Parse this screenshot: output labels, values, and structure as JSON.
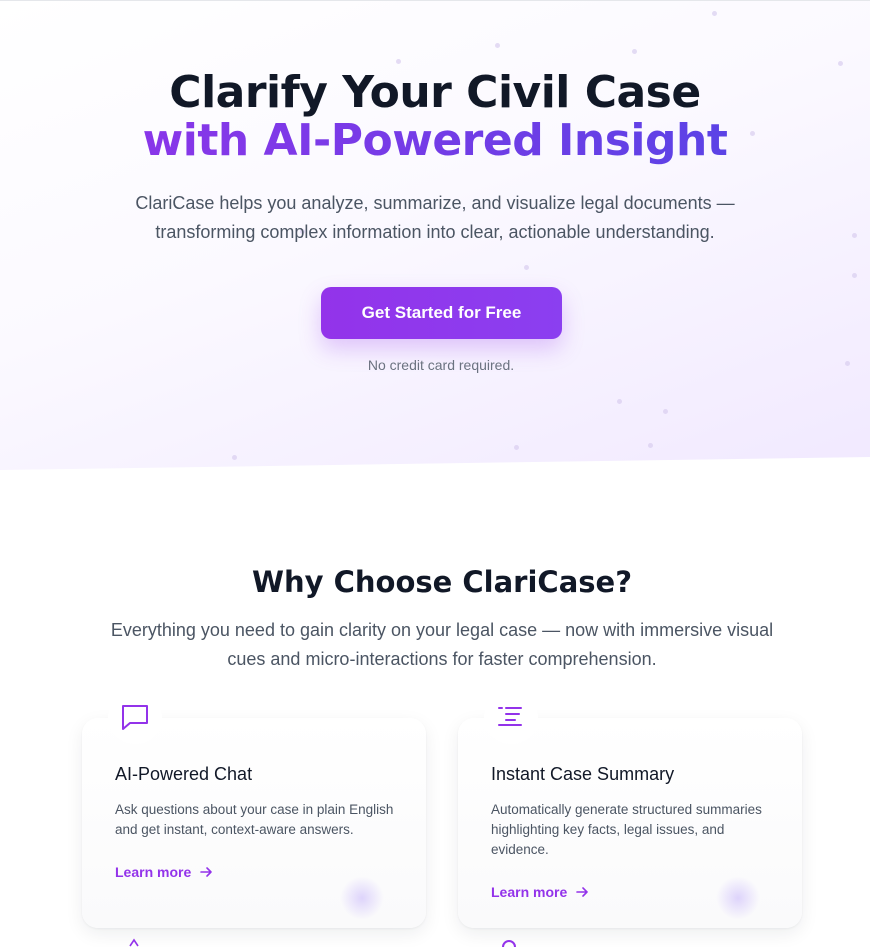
{
  "hero": {
    "title_line1": "Clarify Your Civil Case",
    "title_line2": "with AI-Powered Insight",
    "subtitle": "ClariCase helps you analyze, summarize, and visualize legal documents — transforming complex information into clear, actionable understanding.",
    "cta_label": "Get Started for Free",
    "cta_note": "No credit card required."
  },
  "why": {
    "title": "Why Choose ClariCase?",
    "subtitle": "Everything you need to gain clarity on your legal case — now with immersive visual cues and micro-interactions for faster comprehension."
  },
  "features": [
    {
      "icon": "chat-bubble-icon",
      "title": "AI-Powered Chat",
      "description": "Ask questions about your case in plain English and get instant, context-aware answers.",
      "link_label": "Learn more"
    },
    {
      "icon": "summary-list-icon",
      "title": "Instant Case Summary",
      "description": "Automatically generate structured summaries highlighting key facts, legal issues, and evidence.",
      "link_label": "Learn more"
    }
  ],
  "colors": {
    "accent": "#9333ea",
    "accent_end": "#4f46e5",
    "heading": "#111827",
    "body_text": "#4b5563"
  }
}
